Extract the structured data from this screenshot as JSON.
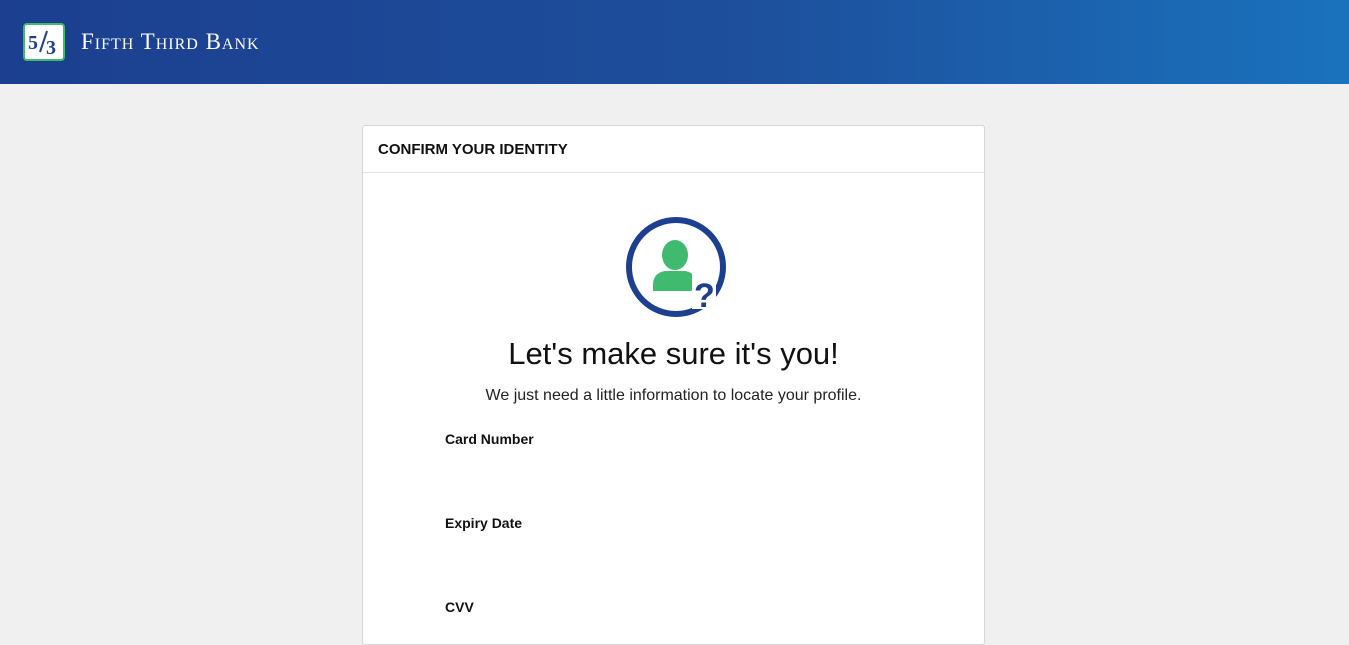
{
  "header": {
    "brand_name": "Fifth Third Bank",
    "logo_icon": "fifth-third-logo-icon",
    "colors": {
      "gradient_start": "#1c3f8f",
      "gradient_end": "#1a72bd"
    }
  },
  "card": {
    "title": "CONFIRM YOUR IDENTITY",
    "icon": "user-question-icon",
    "headline": "Let's make sure it's you!",
    "subtext": "We just need a little information to locate your profile.",
    "fields": {
      "card_number_label": "Card Number",
      "expiry_date_label": "Expiry Date",
      "cvv_label": "CVV"
    },
    "colors": {
      "icon_ring": "#1d3f8f",
      "icon_person": "#3fba6e"
    }
  }
}
